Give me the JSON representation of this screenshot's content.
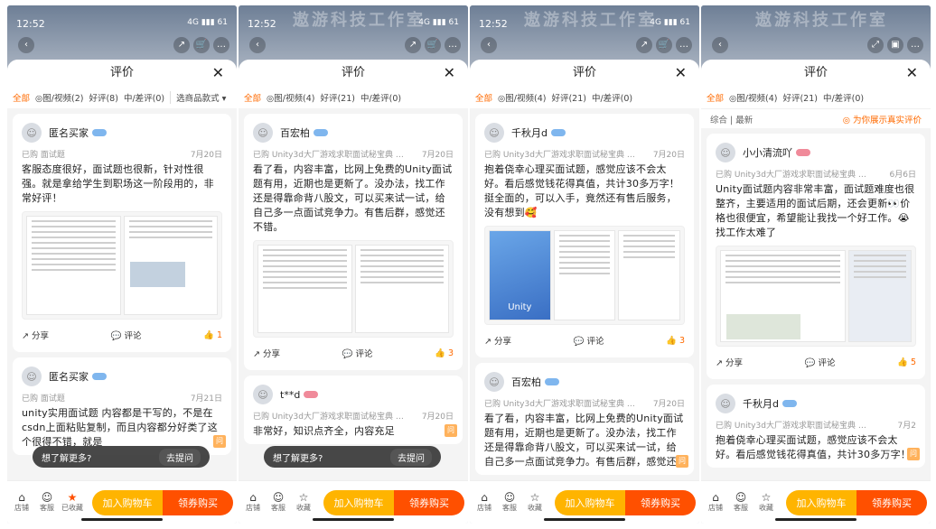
{
  "panels": [
    {
      "status": {
        "time": "12:52",
        "signal": "4G ▮▮▮ 61"
      },
      "sheet_title": "评价",
      "filters": [
        {
          "label": "全部",
          "active": true
        },
        {
          "label": "◎图/视频(2)"
        },
        {
          "label": "好评(8)"
        },
        {
          "label": "中/差评(0)"
        }
      ],
      "sort_label": "选商品款式 ▾",
      "cards": [
        {
          "user": "匿名买家",
          "spec": "已购 面试题",
          "date": "7月20日",
          "text": "客服态度很好，面试题也很新，针对性很强。就是拿给学生到职场这一阶段用的，非常好评！",
          "images": [
            "doc",
            "doc"
          ],
          "share": "分享",
          "comment": "评论",
          "likes": "1"
        },
        {
          "user": "匿名买家",
          "spec": "已购 面试题",
          "date": "7月21日",
          "text": "unity实用面试题\n内容都是干写的，不是在csdn上面粘贴复制，而且内容都分好类了这个很得不错，就是",
          "images": []
        }
      ],
      "toast": {
        "text": "想了解更多?",
        "ask": "去提问"
      },
      "bottom": {
        "icons": [
          "店铺",
          "客服",
          "已收藏"
        ],
        "cart": "加入购物车",
        "buy": "领券购买"
      }
    },
    {
      "status": {
        "time": "12:52",
        "signal": "4G ▮▮▮ 61"
      },
      "watermark": "遨游科技工作室",
      "sheet_title": "评价",
      "filters": [
        {
          "label": "全部",
          "active": true
        },
        {
          "label": "◎图/视频(4)"
        },
        {
          "label": "好评(21)"
        },
        {
          "label": "中/差评(0)"
        }
      ],
      "cards": [
        {
          "user": "百宏柏",
          "spec": "已购 Unity3d大厂游戏求职面试秘宝典 面...",
          "date": "7月20日",
          "text": "看了看，内容丰富，比网上免费的Unity面试题有用，近期也是更新了。没办法，找工作还是得靠命背八股文，可以买来试一试，给自己多一点面试竞争力。有售后群，感觉还不错。",
          "images": [
            "doc",
            "doc"
          ],
          "share": "分享",
          "comment": "评论",
          "likes": "3"
        },
        {
          "user": "t**d",
          "spec": "已购 Unity3d大厂游戏求职面试秘宝典 面...",
          "date": "7月20日",
          "text": "非常好，知识点齐全，内容充足",
          "images": []
        }
      ],
      "toast": {
        "text": "想了解更多?",
        "ask": "去提问"
      },
      "bottom": {
        "icons": [
          "店铺",
          "客服",
          "收藏"
        ],
        "cart": "加入购物车",
        "buy": "领券购买"
      }
    },
    {
      "status": {
        "time": "12:52",
        "signal": "4G ▮▮▮ 61"
      },
      "watermark": "遨游科技工作室",
      "sheet_title": "评价",
      "filters": [
        {
          "label": "全部",
          "active": true
        },
        {
          "label": "◎图/视频(4)"
        },
        {
          "label": "好评(21)"
        },
        {
          "label": "中/差评(0)"
        }
      ],
      "cards": [
        {
          "user": "千秋月d",
          "spec": "已购 Unity3d大厂游戏求职面试秘宝典 面...",
          "date": "7月20日",
          "text": "抱着侥幸心理买面试题，感觉应该不会太好。看后感觉钱花得真值，共计30多万字！挺全面的，可以入手，竟然还有售后服务，没有想到🥰",
          "images": [
            "unity",
            "doc",
            "doc"
          ],
          "share": "分享",
          "comment": "评论",
          "likes": "3"
        },
        {
          "user": "百宏柏",
          "spec": "已购 Unity3d大厂游戏求职面试秘宝典 面...",
          "date": "7月20日",
          "text": "看了看，内容丰富，比网上免费的Unity面试题有用，近期也是更新了。没办法，找工作还是得靠命背八股文，可以买来试一试，给自己多一点面试竞争力。有售后群，感觉还",
          "images": []
        }
      ],
      "bottom": {
        "icons": [
          "店铺",
          "客服",
          "收藏"
        ],
        "cart": "加入购物车",
        "buy": "领券购买"
      }
    },
    {
      "status": {
        "time": "",
        "signal": ""
      },
      "watermark": "遨游科技工作室",
      "sheet_title": "评价",
      "filters": [
        {
          "label": "全部",
          "active": true
        },
        {
          "label": "◎图/视频(4)"
        },
        {
          "label": "好评(21)"
        },
        {
          "label": "中/差评(0)"
        }
      ],
      "subbar": {
        "left": "综合 | 最新",
        "right": "◎ 为你展示真实评价"
      },
      "cards": [
        {
          "user": "小小清流吖",
          "spec": "已购 Unity3d大厂游戏求职面试秘宝典 面...",
          "date": "6月6日",
          "text": "Unity面试题内容非常丰富，面试题难度也很整齐，主要适用的面试后期，还会更新👀价格也很便宜，希望能让我找一个好工作。😭 找工作太难了",
          "images": [
            "doc",
            "photo"
          ],
          "share": "分享",
          "comment": "评论",
          "likes": "5"
        },
        {
          "user": "千秋月d",
          "spec": "已购 Unity3d大厂游戏求职面试秘宝典 面...",
          "date": "7月2",
          "text": "抱着侥幸心理买面试题，感觉应该不会太好。看后感觉钱花得真值，共计30多万字！",
          "images": []
        }
      ],
      "bottom": {
        "icons": [
          "店铺",
          "客服",
          "收藏"
        ],
        "cart": "加入购物车",
        "buy": "领券购买"
      }
    }
  ]
}
